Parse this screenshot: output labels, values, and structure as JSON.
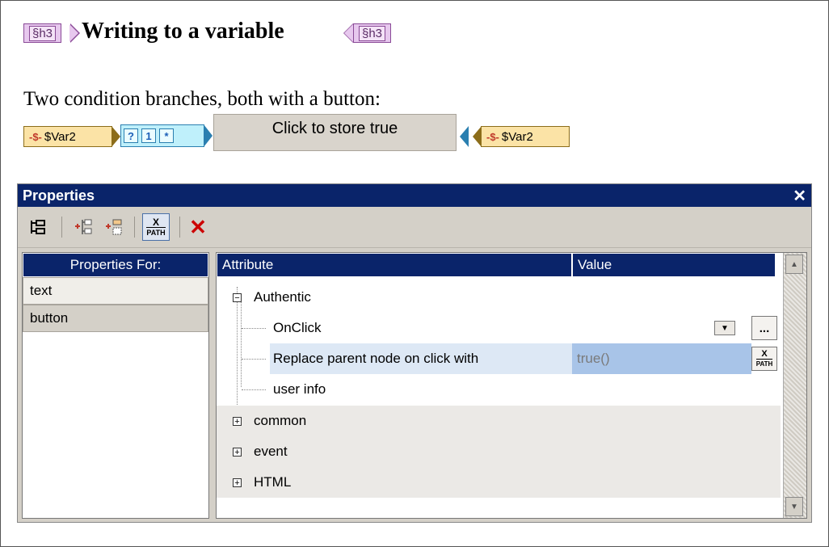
{
  "heading": {
    "tag_label": "§h3",
    "title": "Writing to a variable"
  },
  "paragraph": "Two condition branches, both with a button:",
  "design_row": {
    "var_start_tag": "$Var2",
    "cond_markers": [
      "?",
      "1",
      "*"
    ],
    "button_label": "Click to store true",
    "var_end_tag": "$Var2"
  },
  "properties": {
    "title": "Properties",
    "close_glyph": "✕",
    "toolbar": {
      "xpath_label_top": "X",
      "xpath_label_bottom": "PATH",
      "delete_glyph": "✕"
    },
    "left": {
      "header": "Properties For:",
      "items": [
        "text",
        "button"
      ]
    },
    "grid": {
      "col_attribute": "Attribute",
      "col_value": "Value",
      "groups": [
        {
          "label": "Authentic",
          "expanded": true
        },
        {
          "label": "common",
          "expanded": false
        },
        {
          "label": "event",
          "expanded": false
        },
        {
          "label": "HTML",
          "expanded": false
        }
      ],
      "rows": [
        {
          "name": "OnClick",
          "value": ""
        },
        {
          "name": "Replace parent node on click with",
          "value": "true()"
        },
        {
          "name": "user info",
          "value": ""
        }
      ],
      "ellipsis": "...",
      "expand_glyph": "⊞",
      "collapse_glyph": "⊟"
    }
  },
  "colors": {
    "title_bar": "#0a246a",
    "highlight_value": "#a8c4e8",
    "h3_tag": "#e7c8ee",
    "var_tag": "#fbe3a6",
    "cond_tag": "#bff0fb"
  }
}
